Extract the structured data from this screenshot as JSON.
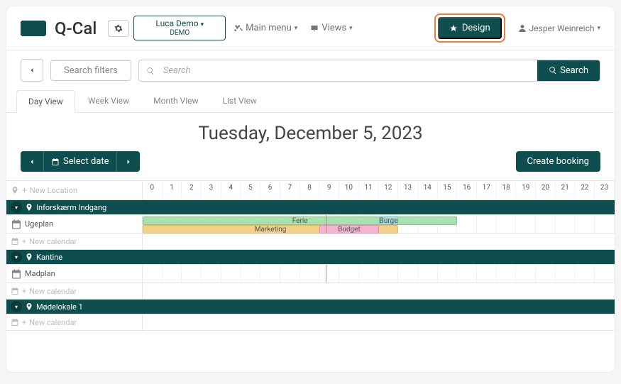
{
  "topbar": {
    "logo_text": "Q-Cal",
    "org_name": "Luca Demo",
    "org_sub": "DEMO",
    "main_menu": "Main menu",
    "views": "Views",
    "design": "Design",
    "user": "Jesper Weinreich"
  },
  "search": {
    "filters": "Search filters",
    "placeholder": "Search",
    "button": "Search"
  },
  "tabs": {
    "day": "Day View",
    "week": "Week View",
    "month": "Month View",
    "list": "List View"
  },
  "date_header": "Tuesday, December 5, 2023",
  "actions": {
    "select_date": "Select date",
    "create": "Create booking"
  },
  "grid": {
    "new_location": "New Location",
    "new_calendar": "New calendar",
    "hours": [
      "0",
      "1",
      "2",
      "3",
      "4",
      "5",
      "6",
      "7",
      "8",
      "9",
      "10",
      "11",
      "12",
      "13",
      "14",
      "15",
      "16",
      "17",
      "18",
      "19",
      "20",
      "21",
      "22",
      "23"
    ],
    "groups": [
      {
        "name": "Inforskærm Indgang",
        "calendars": [
          "Ugeplan"
        ]
      },
      {
        "name": "Kantine",
        "calendars": [
          "Madplan"
        ]
      },
      {
        "name": "Mødelokale 1",
        "calendars": []
      }
    ],
    "events": [
      {
        "label": "Ferie",
        "class": "ev-green",
        "start": 0,
        "end": 16,
        "row": 0
      },
      {
        "label": "Marketing",
        "class": "ev-orange",
        "start": 0,
        "end": 13,
        "row": 1
      },
      {
        "label": "Burger",
        "class": "ev-teal",
        "start": 12,
        "end": 13,
        "row": 0
      },
      {
        "label": "Budget",
        "class": "ev-pink",
        "start": 9,
        "end": 12,
        "row": 1
      }
    ],
    "timeline_hour": 9.3
  }
}
